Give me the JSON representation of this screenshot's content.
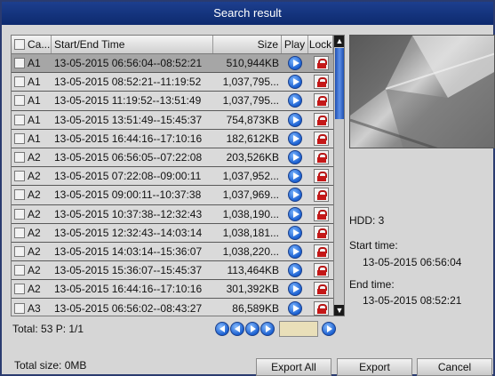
{
  "window": {
    "title": "Search result"
  },
  "table": {
    "headers": {
      "camera": "Ca...",
      "time": "Start/End Time",
      "size": "Size",
      "play": "Play",
      "lock": "Lock"
    },
    "rows": [
      {
        "camera": "A1",
        "time": "13-05-2015 06:56:04--08:52:21",
        "size": "510,944KB",
        "selected": true
      },
      {
        "camera": "A1",
        "time": "13-05-2015 08:52:21--11:19:52",
        "size": "1,037,795..."
      },
      {
        "camera": "A1",
        "time": "13-05-2015 11:19:52--13:51:49",
        "size": "1,037,795..."
      },
      {
        "camera": "A1",
        "time": "13-05-2015 13:51:49--15:45:37",
        "size": "754,873KB"
      },
      {
        "camera": "A1",
        "time": "13-05-2015 16:44:16--17:10:16",
        "size": "182,612KB"
      },
      {
        "camera": "A2",
        "time": "13-05-2015 06:56:05--07:22:08",
        "size": "203,526KB"
      },
      {
        "camera": "A2",
        "time": "13-05-2015 07:22:08--09:00:11",
        "size": "1,037,952..."
      },
      {
        "camera": "A2",
        "time": "13-05-2015 09:00:11--10:37:38",
        "size": "1,037,969..."
      },
      {
        "camera": "A2",
        "time": "13-05-2015 10:37:38--12:32:43",
        "size": "1,038,190..."
      },
      {
        "camera": "A2",
        "time": "13-05-2015 12:32:43--14:03:14",
        "size": "1,038,181..."
      },
      {
        "camera": "A2",
        "time": "13-05-2015 14:03:14--15:36:07",
        "size": "1,038,220..."
      },
      {
        "camera": "A2",
        "time": "13-05-2015 15:36:07--15:45:37",
        "size": "113,464KB"
      },
      {
        "camera": "A2",
        "time": "13-05-2015 16:44:16--17:10:16",
        "size": "301,392KB"
      },
      {
        "camera": "A3",
        "time": "13-05-2015 06:56:02--08:43:27",
        "size": "86,589KB"
      }
    ]
  },
  "footer": {
    "total": "Total: 53  P: 1/1"
  },
  "info": {
    "hdd": "HDD: 3",
    "start_label": "Start time:",
    "start_value": "13-05-2015 06:56:04",
    "end_label": "End time:",
    "end_value": "13-05-2015 08:52:21"
  },
  "bottom": {
    "total_size": "Total size: 0MB",
    "export_all": "Export All",
    "export": "Export",
    "cancel": "Cancel"
  },
  "icons": {
    "play": "play-icon",
    "lock": "lock-icon",
    "nav": [
      "first-page-icon",
      "prev-page-icon",
      "next-page-icon",
      "last-page-icon",
      "go-page-icon"
    ]
  }
}
